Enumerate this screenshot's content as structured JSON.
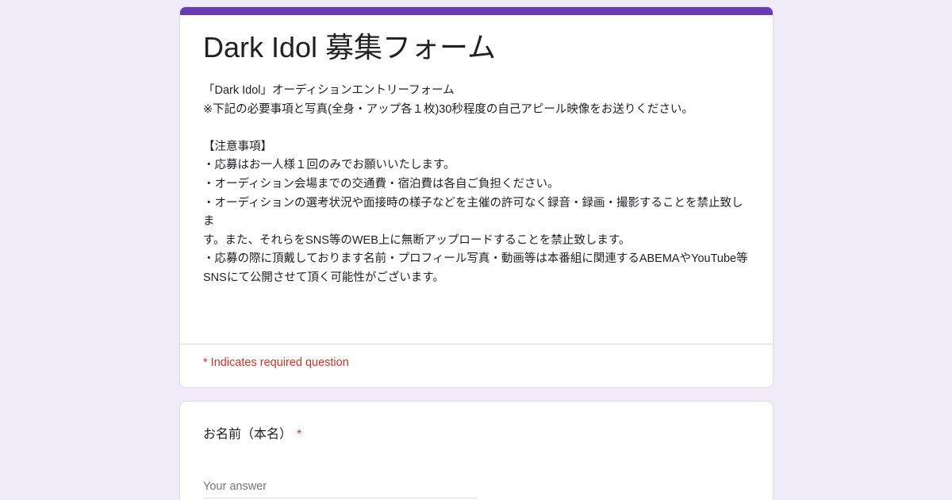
{
  "form": {
    "title": "Dark Idol 募集フォーム",
    "description": "「Dark Idol」オーディションエントリーフォーム\n※下記の必要事項と写真(全身・アップ各１枚)30秒程度の自己アピール映像をお送りください。\n\n【注意事項】\n・応募はお一人様１回のみでお願いいたします。\n・オーディション会場までの交通費・宿泊費は各自ご負担ください。\n・オーディションの選考状況や面接時の様子などを主催の許可なく録音・録画・撮影することを禁止致しま\nす。また、それらをSNS等のWEB上に無断アップロードすることを禁止致します。\n・応募の際に頂戴しております名前・プロフィール写真・動画等は本番組に関連するABEMAやYouTube等\nSNSにて公開させて頂く可能性がございます。",
    "required_note": "* Indicates required question",
    "accent_color": "#673ab7"
  },
  "question": {
    "label": "お名前（本名）",
    "required_mark": "*",
    "placeholder": "Your answer"
  }
}
